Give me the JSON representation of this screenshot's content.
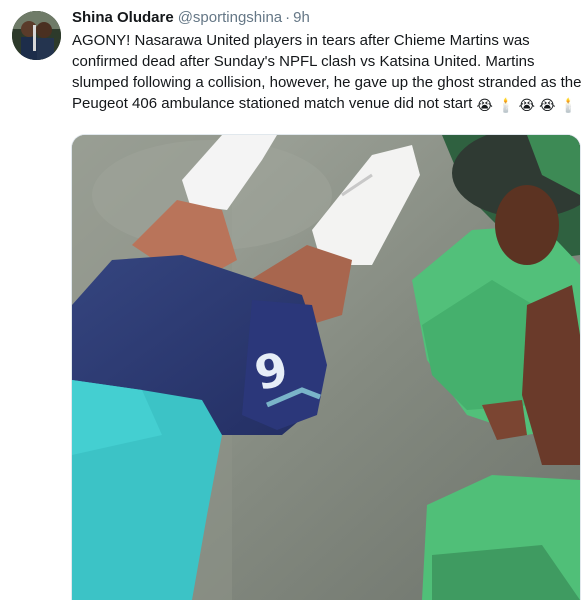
{
  "tweet": {
    "author_name": "Shina Oludare",
    "handle": "@sportingshina",
    "separator": "·",
    "time": "9h",
    "text": "AGONY! Nasarawa United players in tears after Chieme Martins was confirmed dead after Sunday's NPFL clash vs Katsina United. Martins slumped following a collision, however, he gave up the ghost stranded as the Peugeot 406 ambulance stationed match venue did not start",
    "emojis": [
      "😭",
      "🕯️",
      "😭",
      "😭",
      "🕯️"
    ]
  },
  "media": {
    "icon": "video-still-image",
    "shorts_number": "9"
  },
  "colors": {
    "text": "#14171a",
    "secondary": "#657786"
  }
}
